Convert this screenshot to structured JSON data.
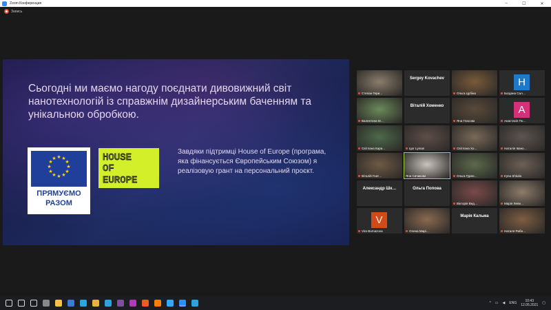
{
  "window": {
    "title": "Zoom Конференция",
    "minimize": "–",
    "maximize": "☐",
    "close": "✕"
  },
  "recording": {
    "label": "Запись"
  },
  "slide": {
    "headline": "Сьогодні ми маємо нагоду поєднати дивовижний світ нанотехнологій із справжнім дизайнерським баченням та унікальною обробкою.",
    "eu_logo_text_1": "ПРЯМУЄМО",
    "eu_logo_text_2": "РАЗОМ",
    "hoe_logo_text_1": "HOUSE",
    "hoe_logo_text_2": "OF",
    "hoe_logo_text_3": "EUROPE",
    "grant_text": "Завдяки підтримці House of Europe (програма, яка фінансується Європейським Союзом) я реалізовую грант на персональний проєкт."
  },
  "participants": [
    {
      "name": "Степан Гери…",
      "type": "video",
      "color": "#8a7d6c",
      "mic_off": true
    },
    {
      "name": "Sergey Kovachev",
      "type": "name",
      "mic_off": false
    },
    {
      "name": "Ольга Цубіна",
      "type": "video",
      "color": "#7a5a3a",
      "mic_off": true
    },
    {
      "name": "Богдана Сал…",
      "type": "avatar",
      "letter": "H",
      "color": "#1f78c8",
      "mic_off": true
    },
    {
      "name": "Валентина М…",
      "type": "video",
      "color": "#6b8a5a",
      "mic_off": true
    },
    {
      "name": "Віталій Хоменко",
      "type": "name",
      "mic_off": false
    },
    {
      "name": "Яна Гласова",
      "type": "video",
      "color": "#5a4a3a",
      "mic_off": true
    },
    {
      "name": "Анастасія По…",
      "type": "avatar",
      "letter": "A",
      "color": "#d5307a",
      "mic_off": true
    },
    {
      "name": "Світлана Кара…",
      "type": "video",
      "color": "#4d6a4a",
      "mic_off": true
    },
    {
      "name": "Igor Lyman",
      "type": "video",
      "color": "#5e4e48",
      "mic_off": true
    },
    {
      "name": "Світлана Хо…",
      "type": "video",
      "color": "#7a6a58",
      "mic_off": true
    },
    {
      "name": "Наталія Івано…",
      "type": "video",
      "color": "#5d5550",
      "mic_off": true
    },
    {
      "name": "Віталій Гнат…",
      "type": "video",
      "color": "#6f5a45",
      "mic_off": true
    },
    {
      "name": "Яна Сичикова",
      "type": "video",
      "color": "#c9c4bc",
      "mic_off": false,
      "speaking": true
    },
    {
      "name": "Ольга Гурен…",
      "type": "video",
      "color": "#5c6a4c",
      "mic_off": true
    },
    {
      "name": "Iryna Shkola",
      "type": "video",
      "color": "#6d6056",
      "mic_off": true
    },
    {
      "name": "Александр Шк…",
      "type": "name",
      "mic_off": false
    },
    {
      "name": "Ольга Попова",
      "type": "name",
      "mic_off": false
    },
    {
      "name": "Вікторія Вед…",
      "type": "video",
      "color": "#7a4a4a",
      "mic_off": true
    },
    {
      "name": "Марія Лепи…",
      "type": "video",
      "color": "#8d7c6a",
      "mic_off": true
    },
    {
      "name": "Vira Burnazova",
      "type": "avatar",
      "letter": "V",
      "color": "#d24a17",
      "mic_off": true
    },
    {
      "name": "Олена Марі…",
      "type": "video",
      "color": "#8a6a52",
      "mic_off": true
    },
    {
      "name": "Марія Кальма",
      "type": "name",
      "mic_off": false
    },
    {
      "name": "Наталя Рибн…",
      "type": "video",
      "color": "#7e5e42",
      "mic_off": true
    }
  ],
  "taskbar": {
    "icons": [
      "windows-icon",
      "search-icon",
      "task-view-icon",
      "calculator-icon",
      "explorer-icon",
      "store-icon",
      "edge-icon",
      "chrome-icon",
      "telegram-icon",
      "viber-icon",
      "messenger-icon",
      "brave-icon",
      "illustrator-icon",
      "photoshop-icon",
      "zoom-icon",
      "telegram2-icon"
    ],
    "icon_colors": [
      "#ffffff",
      "#ffffff",
      "#ffffff",
      "#888888",
      "#f5c242",
      "#3a7bd5",
      "#2aa7e1",
      "#e8b33a",
      "#2aa3df",
      "#7b519d",
      "#b13ab8",
      "#f05a28",
      "#ff7c00",
      "#31a8ff",
      "#2d8cff",
      "#2aa3df"
    ],
    "lang": "ENG",
    "time": "10:43",
    "date": "12.05.2021"
  }
}
